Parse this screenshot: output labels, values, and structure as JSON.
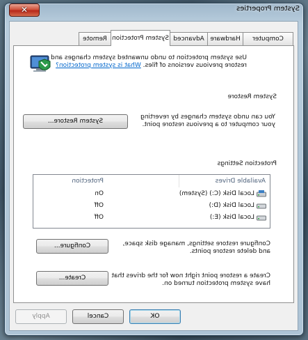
{
  "window": {
    "title": "System Properties",
    "close_symbol": "✕"
  },
  "tabs": [
    {
      "label": "Computer Name",
      "active": false
    },
    {
      "label": "Hardware",
      "active": false
    },
    {
      "label": "Advanced",
      "active": false
    },
    {
      "label": "System Protection",
      "active": true
    },
    {
      "label": "Remote",
      "active": false
    }
  ],
  "intro": {
    "line1": "Use system protection to undo unwanted system changes and",
    "line2_text": "restore previous versions of files.",
    "line2_link": "What is system protection?"
  },
  "system_restore": {
    "group_title": "System Restore",
    "line1": "You can undo system changes by reverting",
    "line2": "your computer to a previous restore point.",
    "button_label": "System Restore..."
  },
  "protection_settings": {
    "group_title": "Protection Settings",
    "columns": [
      "Available Drives",
      "Protection"
    ],
    "drives": [
      {
        "name": "Local Disk (C:) (System)",
        "protection": "On",
        "icon": "system-drive-icon"
      },
      {
        "name": "Local Disk (D:)",
        "protection": "Off",
        "icon": "drive-icon"
      },
      {
        "name": "Local Disk (E:)",
        "protection": "Off",
        "icon": "drive-icon"
      }
    ],
    "configure_line1": "Configure restore settings, manage disk space,",
    "configure_line2": "and delete restore points.",
    "configure_button": "Configure...",
    "create_line1": "Create a restore point right now for the drives that",
    "create_line2": "have system protection turned on.",
    "create_button": "Create..."
  },
  "footer": {
    "ok": "OK",
    "cancel": "Cancel",
    "apply": "Apply"
  },
  "colors": {
    "link": "#0066cc",
    "close_button": "#c8412c",
    "default_button_border": "#3c7fb1"
  }
}
